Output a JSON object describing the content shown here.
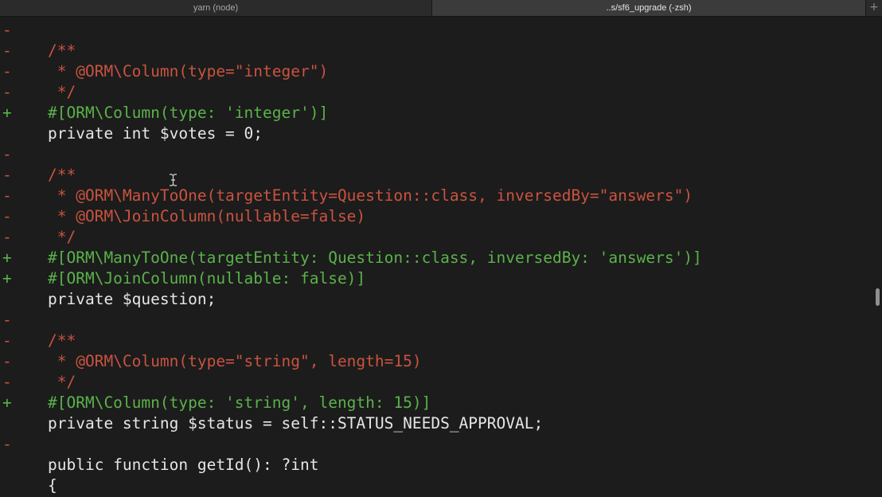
{
  "tabs": [
    {
      "label": "yarn (node)"
    },
    {
      "label": "..s/sf6_upgrade (-zsh)"
    }
  ],
  "new_tab_icon": "plus-icon",
  "colors": {
    "removed": "#c9533f",
    "added": "#5ab24a",
    "plain": "#e6e6e6",
    "background": "#1c1c1c"
  },
  "lines": [
    {
      "marker": "-",
      "text": "",
      "kind": "removed"
    },
    {
      "marker": "-",
      "text": "/**",
      "kind": "removed"
    },
    {
      "marker": "-",
      "text": " * @ORM\\Column(type=\"integer\")",
      "kind": "removed"
    },
    {
      "marker": "-",
      "text": " */",
      "kind": "removed"
    },
    {
      "marker": "+",
      "text": "#[ORM\\Column(type: 'integer')]",
      "kind": "added"
    },
    {
      "marker": "",
      "text": "private int $votes = 0;",
      "kind": "plain"
    },
    {
      "marker": "-",
      "text": "",
      "kind": "removed"
    },
    {
      "marker": "-",
      "text": "/**",
      "kind": "removed"
    },
    {
      "marker": "-",
      "text": " * @ORM\\ManyToOne(targetEntity=Question::class, inversedBy=\"answers\")",
      "kind": "removed"
    },
    {
      "marker": "-",
      "text": " * @ORM\\JoinColumn(nullable=false)",
      "kind": "removed"
    },
    {
      "marker": "-",
      "text": " */",
      "kind": "removed"
    },
    {
      "marker": "+",
      "text": "#[ORM\\ManyToOne(targetEntity: Question::class, inversedBy: 'answers')]",
      "kind": "added"
    },
    {
      "marker": "+",
      "text": "#[ORM\\JoinColumn(nullable: false)]",
      "kind": "added"
    },
    {
      "marker": "",
      "text": "private $question;",
      "kind": "plain"
    },
    {
      "marker": "-",
      "text": "",
      "kind": "removed"
    },
    {
      "marker": "-",
      "text": "/**",
      "kind": "removed"
    },
    {
      "marker": "-",
      "text": " * @ORM\\Column(type=\"string\", length=15)",
      "kind": "removed"
    },
    {
      "marker": "-",
      "text": " */",
      "kind": "removed"
    },
    {
      "marker": "+",
      "text": "#[ORM\\Column(type: 'string', length: 15)]",
      "kind": "added"
    },
    {
      "marker": "",
      "text": "private string $status = self::STATUS_NEEDS_APPROVAL;",
      "kind": "plain"
    },
    {
      "marker": "-",
      "text": "",
      "kind": "removed"
    },
    {
      "marker": "",
      "text": "public function getId(): ?int",
      "kind": "plain"
    },
    {
      "marker": "",
      "text": "{",
      "kind": "plain"
    }
  ]
}
